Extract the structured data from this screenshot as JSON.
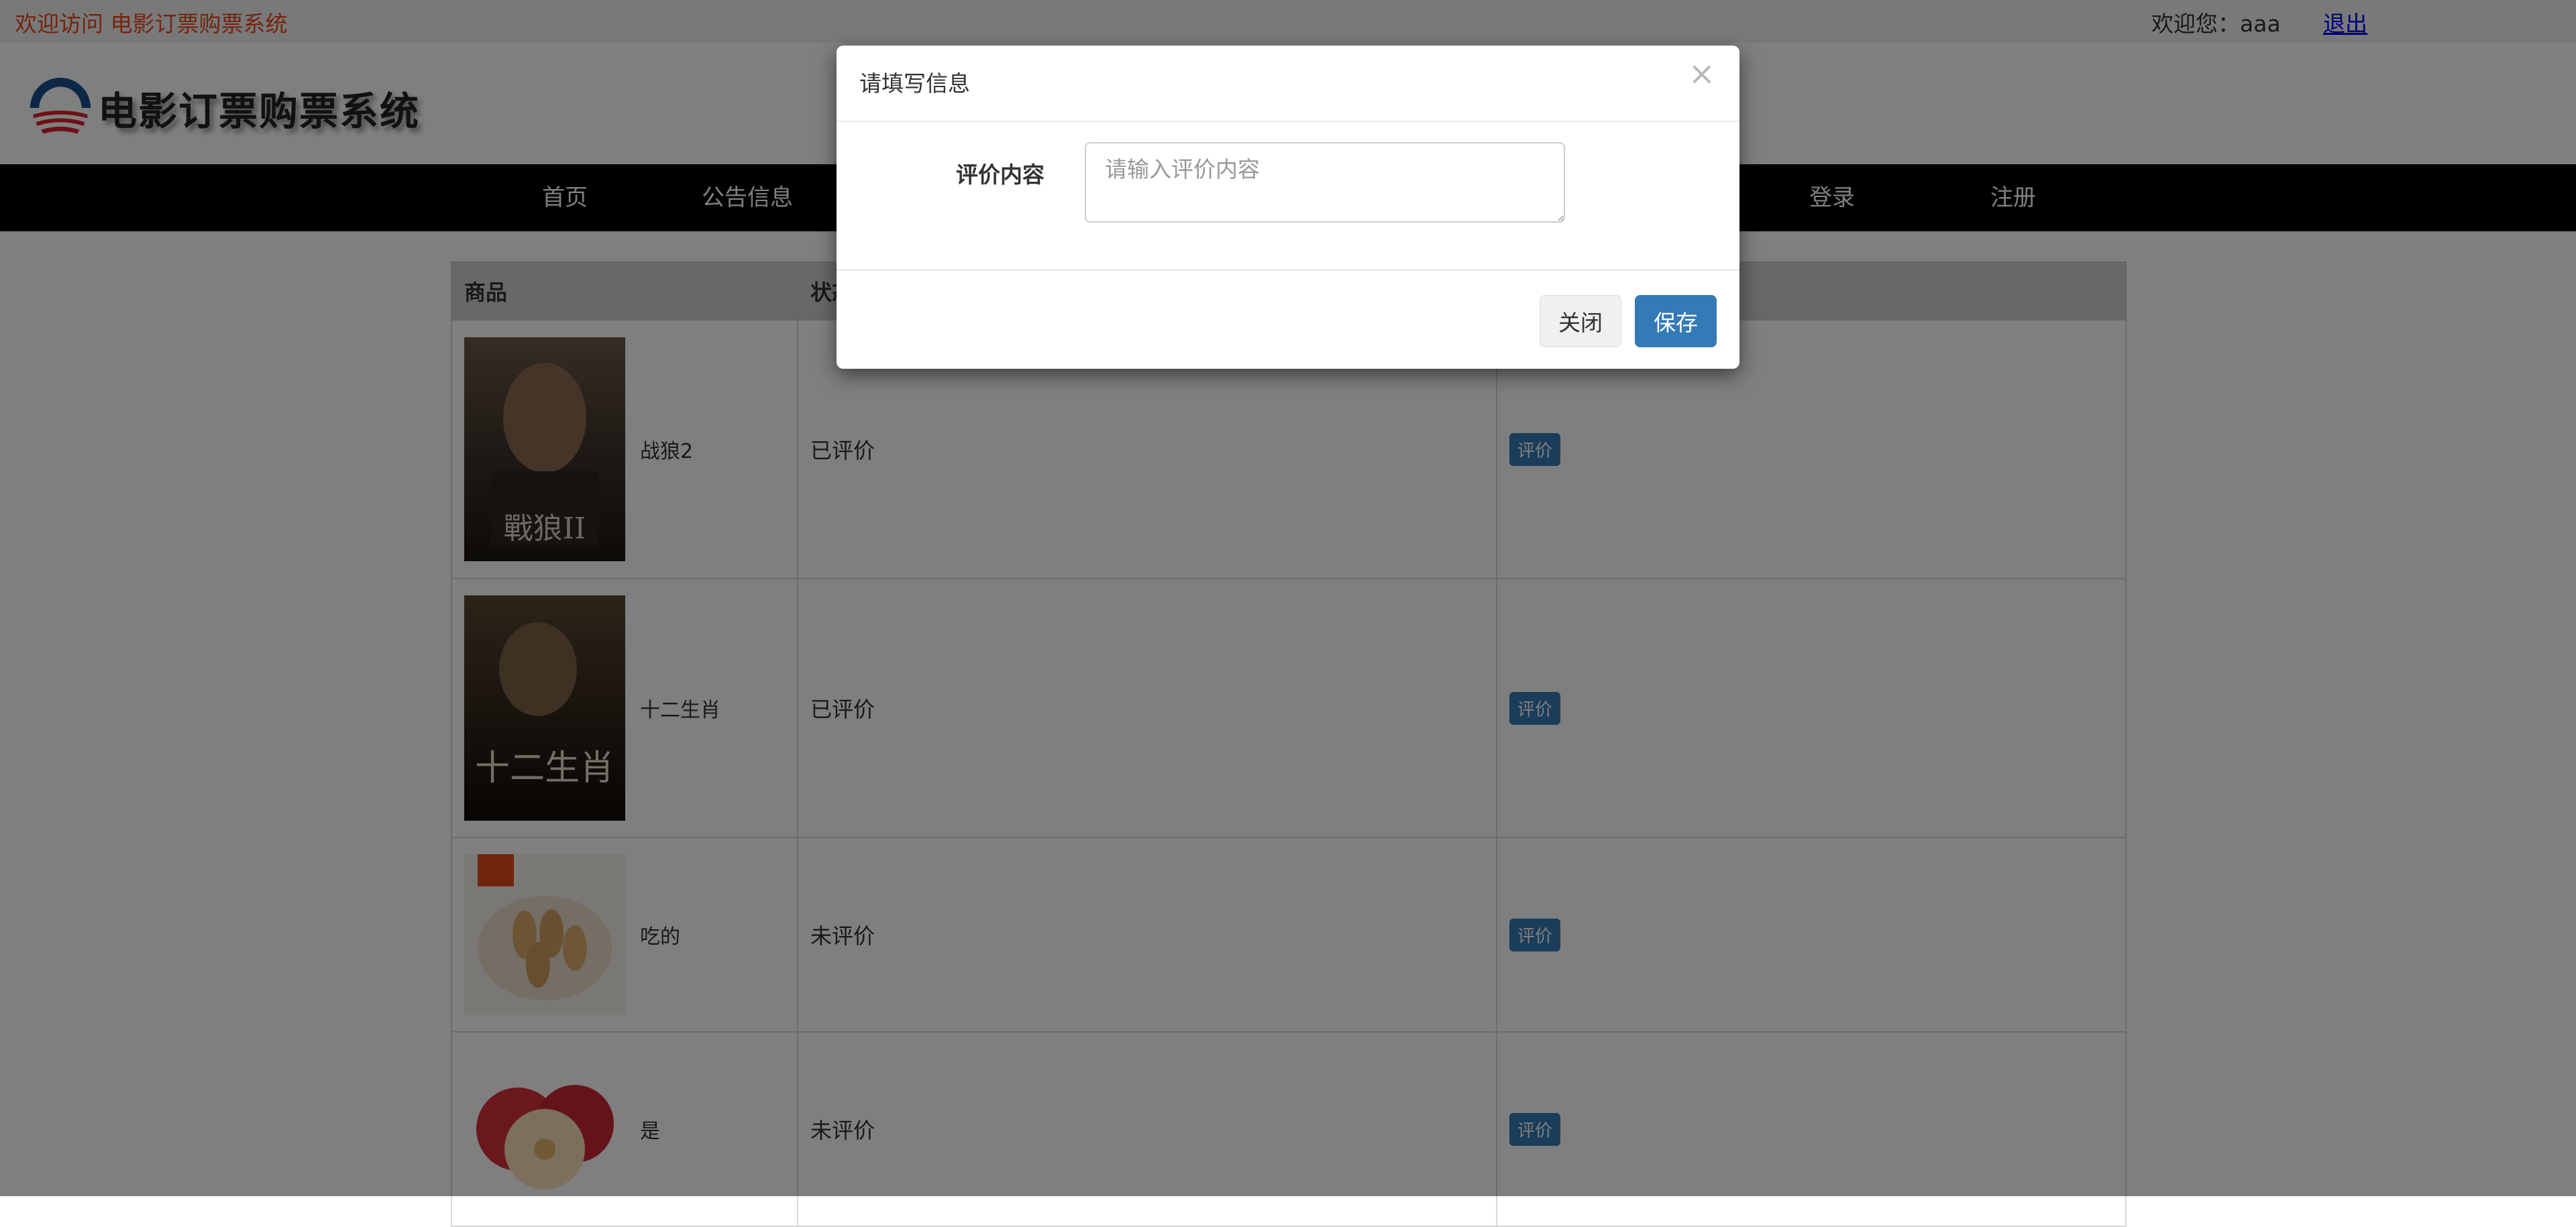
{
  "topbar": {
    "welcome_left": "欢迎访问 电影订票购票系统",
    "welcome_user": "欢迎您：aaa",
    "logout_label": "退出"
  },
  "header": {
    "logo_text": "电影订票购票系统",
    "logo_icon": "circle-logo-icon"
  },
  "nav": {
    "items": [
      "首页",
      "公告信息",
      "",
      "",
      "",
      "",
      "",
      "登录",
      "注册"
    ]
  },
  "table": {
    "headers": [
      "商品",
      "状态",
      ""
    ],
    "rows": [
      {
        "name": "战狼2",
        "status": "已评价",
        "action": "评价"
      },
      {
        "name": "十二生肖",
        "status": "已评价",
        "action": "评价"
      },
      {
        "name": "吃的",
        "status": "未评价",
        "action": "评价"
      },
      {
        "name": "是",
        "status": "未评价",
        "action": "评价"
      }
    ]
  },
  "modal": {
    "title": "请填写信息",
    "close_icon": "×",
    "field_label": "评价内容",
    "textarea_placeholder": "请输入评价内容",
    "textarea_value": "",
    "btn_close": "关闭",
    "btn_save": "保存"
  },
  "colors": {
    "accent": "#337ab7",
    "welcome_text": "#e8491d",
    "nav_bg": "#000000"
  }
}
